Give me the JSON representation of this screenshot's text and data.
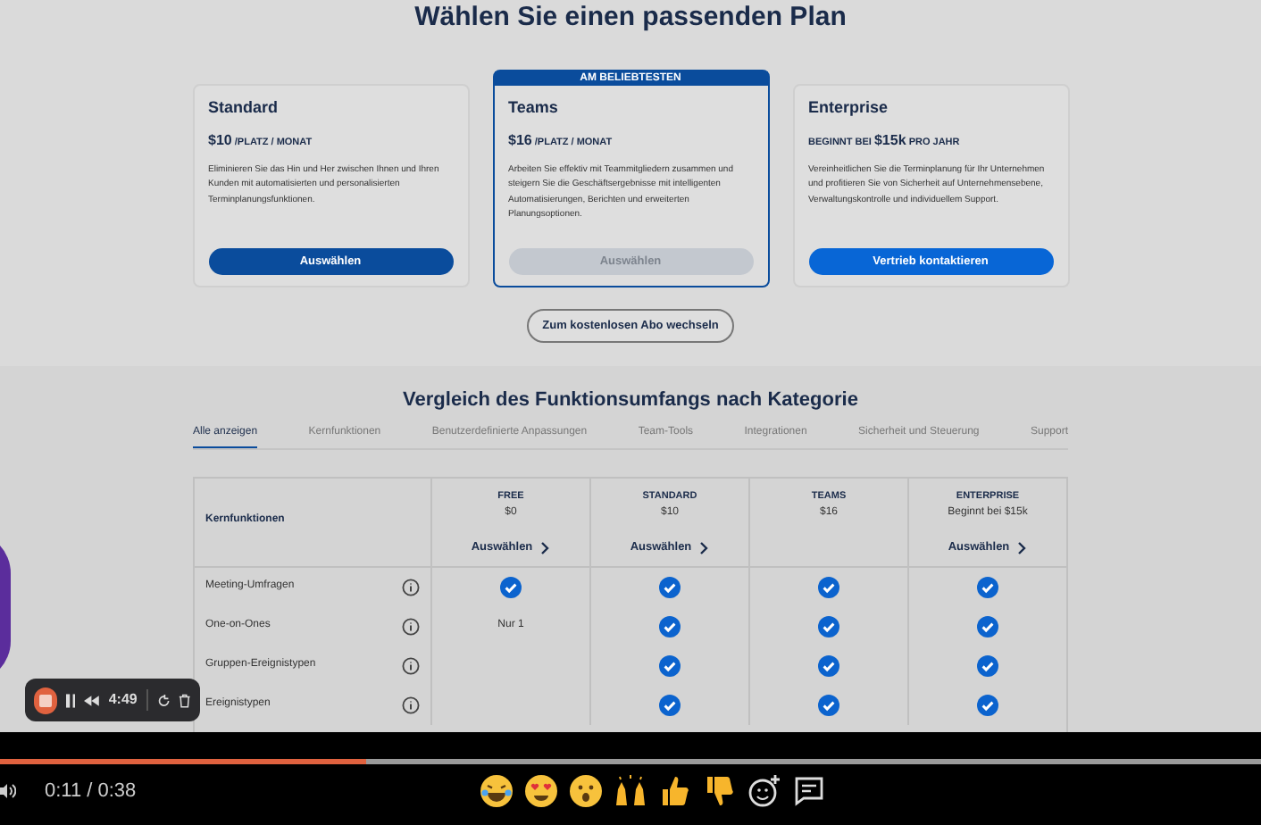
{
  "page_title": "Wählen Sie einen passenden Plan",
  "plans": [
    {
      "name": "Standard",
      "price": "$10",
      "price_suffix": "/PLATZ / MONAT",
      "description": "Eliminieren Sie das Hin und Her zwischen Ihnen und Ihren Kunden mit automatisierten und personalisierten Terminplanungsfunktionen.",
      "button": {
        "label": "Auswählen",
        "kind": "primary"
      }
    },
    {
      "name": "Teams",
      "price": "$16",
      "price_suffix": "/PLATZ / MONAT",
      "description": "Arbeiten Sie effektiv mit Teammitgliedern zusammen und steigern Sie die Geschäftsergebnisse mit intelligenten Automatisierungen, Berichten und erweiterten Planungsoptionen.",
      "button": {
        "label": "Auswählen",
        "kind": "disabled"
      },
      "badge": "AM BELIEBTESTEN"
    },
    {
      "name": "Enterprise",
      "price": "$15k",
      "price_prefix": "BEGINNT BEI",
      "price_suffix": "PRO JAHR",
      "description": "Vereinheitlichen Sie die Terminplanung für Ihr Unternehmen und profitieren Sie von Sicherheit auf Unternehmensebene, Verwaltungskontrolle und individuellem Support.",
      "button": {
        "label": "Vertrieb kontaktieren",
        "kind": "accent"
      }
    }
  ],
  "free_button": "Zum kostenlosen Abo wechseln",
  "comparison_title": "Vergleich des Funktionsumfangs nach Kategorie",
  "tabs": [
    {
      "label": "Alle anzeigen",
      "selected": true
    },
    {
      "label": "Kernfunktionen",
      "selected": false
    },
    {
      "label": "Benutzerdefinierte Anpassungen",
      "selected": false
    },
    {
      "label": "Team-Tools",
      "selected": false
    },
    {
      "label": "Integrationen",
      "selected": false
    },
    {
      "label": "Sicherheit und Steuerung",
      "selected": false
    },
    {
      "label": "Support",
      "selected": false
    }
  ],
  "table": {
    "section": "Kernfunktionen",
    "columns": [
      {
        "name": "FREE",
        "price": "$0",
        "action": "Auswählen"
      },
      {
        "name": "STANDARD",
        "price": "$10",
        "action": "Auswählen"
      },
      {
        "name": "TEAMS",
        "price": "$16"
      },
      {
        "name": "ENTERPRISE",
        "price": "Beginnt bei $15k",
        "action": "Auswählen"
      }
    ],
    "rows": [
      {
        "name": "Meeting-Umfragen",
        "cells": [
          {
            "kind": "check"
          },
          {
            "kind": "check"
          },
          {
            "kind": "check"
          },
          {
            "kind": "check"
          }
        ]
      },
      {
        "name": "One-on-Ones",
        "cells": [
          {
            "kind": "text",
            "text": "Nur 1"
          },
          {
            "kind": "check"
          },
          {
            "kind": "check"
          },
          {
            "kind": "check"
          }
        ]
      },
      {
        "name": "Gruppen-Ereignistypen",
        "cells": [
          {
            "kind": "empty"
          },
          {
            "kind": "check"
          },
          {
            "kind": "check"
          },
          {
            "kind": "check"
          }
        ]
      },
      {
        "name": "Ereignistypen",
        "cells": [
          {
            "kind": "empty"
          },
          {
            "kind": "check"
          },
          {
            "kind": "check"
          },
          {
            "kind": "check"
          }
        ]
      }
    ]
  },
  "recorder": {
    "time": "4:49"
  },
  "player": {
    "time": "0:11 / 0:38",
    "level": 0.29
  }
}
